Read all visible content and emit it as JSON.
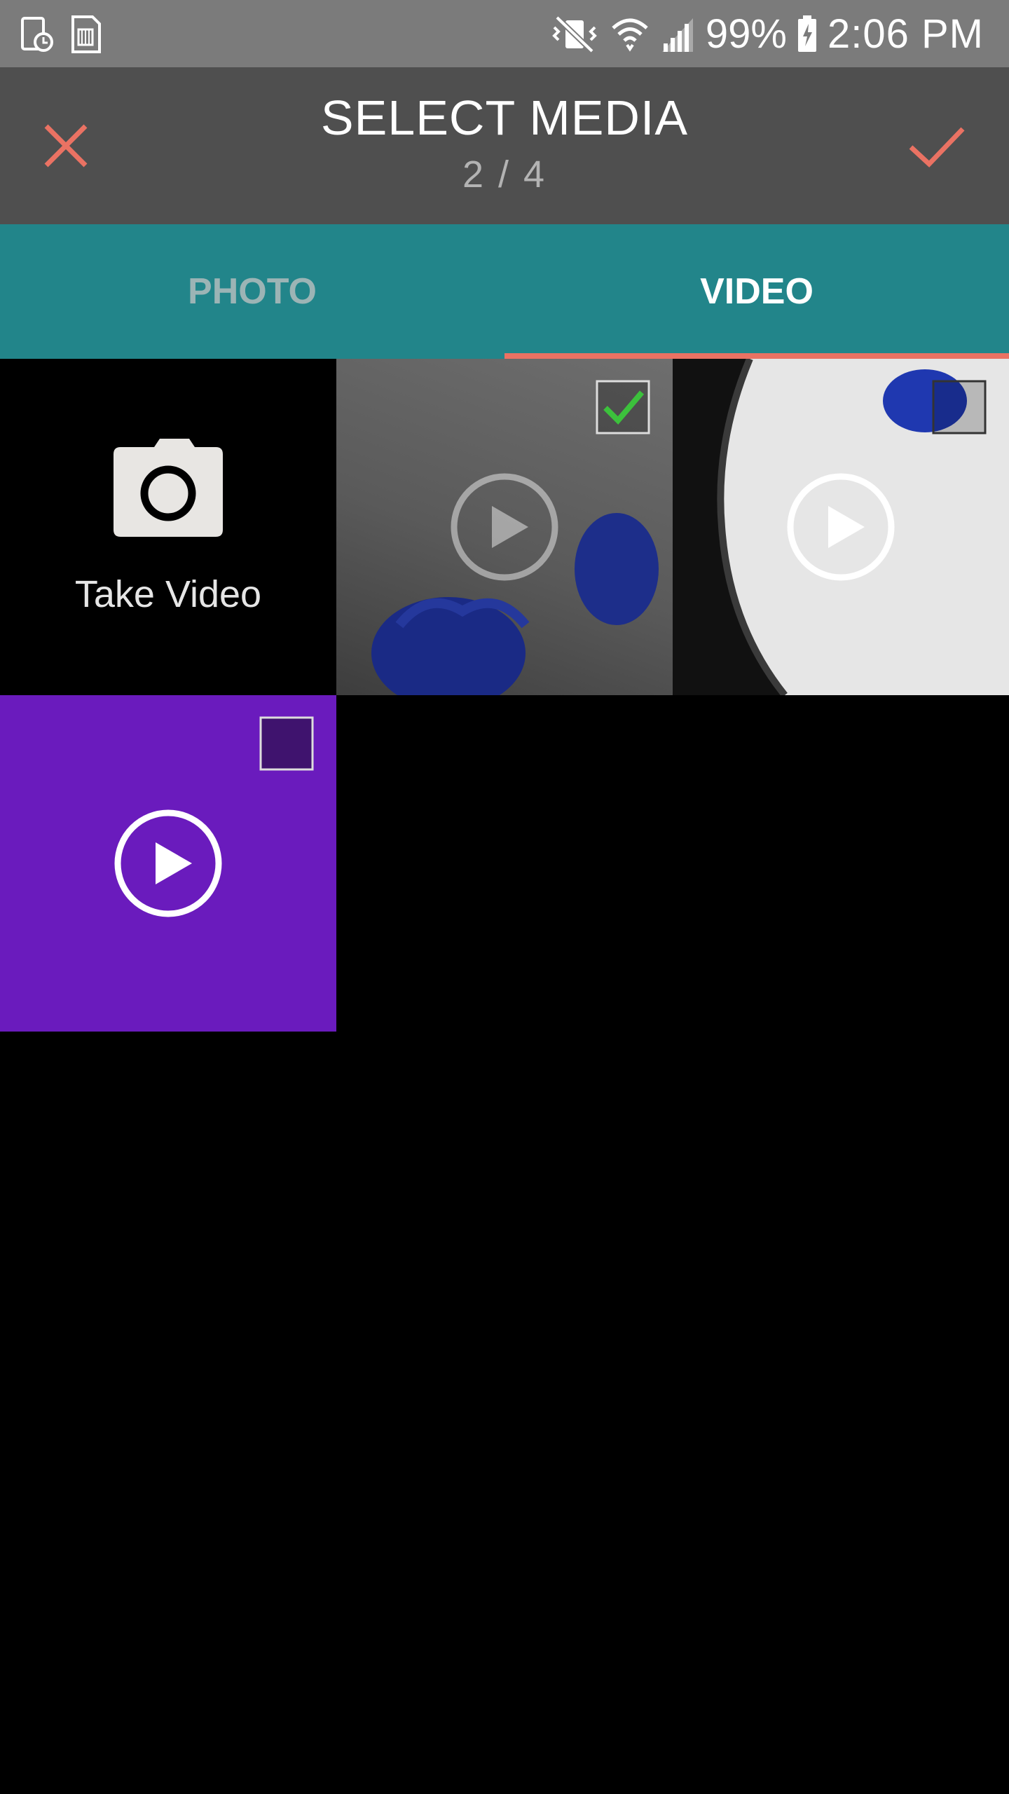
{
  "status_bar": {
    "battery": "99%",
    "time": "2:06 PM",
    "icons": [
      "device-clock-icon",
      "sd-card-icon",
      "vibrate-mute-icon",
      "wifi-icon",
      "signal-icon",
      "battery-charging-icon"
    ]
  },
  "app_bar": {
    "title": "SELECT MEDIA",
    "count": "2 / 4",
    "close_icon": "close-icon",
    "confirm_icon": "check-icon",
    "accent": "#ea7263"
  },
  "tabs": [
    {
      "label": "PHOTO",
      "selected": false
    },
    {
      "label": "VIDEO",
      "selected": true
    }
  ],
  "grid": {
    "take_video_label": "Take Video",
    "items": [
      {
        "type": "video",
        "selected": true
      },
      {
        "type": "video",
        "selected": false
      },
      {
        "type": "video",
        "selected": false
      }
    ]
  },
  "colors": {
    "tab_bar": "#22858a",
    "app_bar": "#4f4f4f",
    "selected_check": "#3cc13c",
    "purple_tile": "#6a1bbd"
  }
}
